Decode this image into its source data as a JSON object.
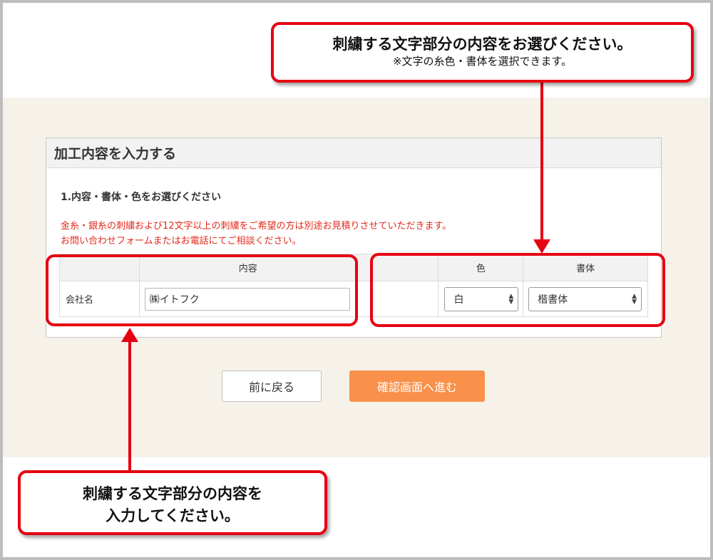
{
  "callouts": {
    "top_title": "刺繍する文字部分の内容をお選びください。",
    "top_note": "※文字の糸色・書体を選択できます。",
    "bottom_line1": "刺繍する文字部分の内容を",
    "bottom_line2": "入力してください。"
  },
  "panel": {
    "title": "加工内容を入力する",
    "section_title": "1.内容・書体・色をお選びください",
    "notice_line1": "金糸・銀糸の刺繍および12文字以上の刺繍をご希望の方は別途お見積りさせていただきます。",
    "notice_line2": "お問い合わせフォームまたはお電話にてご相談ください。"
  },
  "table": {
    "headers": {
      "blank": "",
      "content": "内容",
      "blank2": "",
      "color": "色",
      "font": "書体"
    },
    "row": {
      "label": "会社名",
      "content_value": "㈱イトフク",
      "color_value": "白",
      "font_value": "楷書体"
    }
  },
  "buttons": {
    "back": "前に戻る",
    "next": "確認画面へ進む"
  },
  "colors": {
    "accent_red": "#e60012",
    "notice_red": "#e32a1c",
    "next_button": "#f9914a",
    "band": "#f6f2e9"
  }
}
